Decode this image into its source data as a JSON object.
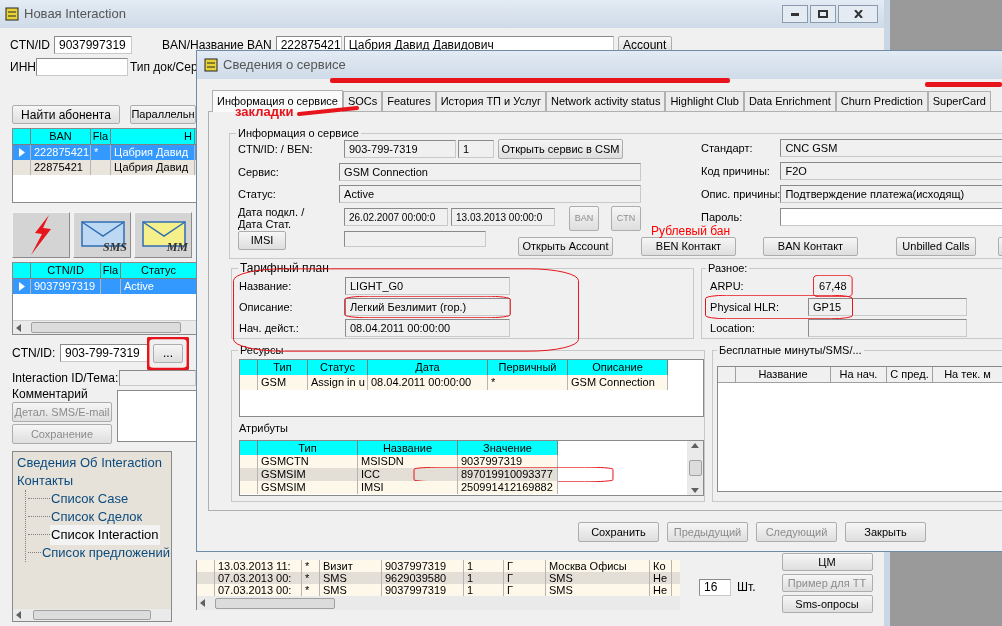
{
  "main_window": {
    "title": "Новая Interaction",
    "search": {
      "ctn_label": "CTN/ID",
      "ctn_value": "9037997319",
      "ban_label": "BAN/Название BAN",
      "ban_value": "222875421",
      "ban_name": "Цабрия Давид Давидович",
      "account_button": "Account",
      "inn_label": "ИНН",
      "doc_label": "Тип док/Сер"
    },
    "buttons": [
      "Найти абонента",
      "Параллельн"
    ],
    "ban_table": {
      "columns": [
        "BAN",
        "Fla",
        "Н"
      ],
      "rows": [
        {
          "ban": "222875421",
          "flag": "*",
          "name": "Цабрия Давид",
          "selected": true
        },
        {
          "ban": "22875421",
          "name": "Цабрия Давид",
          "selected": false
        }
      ]
    },
    "icon_buttons": [
      {
        "kind": "lightning"
      },
      {
        "kind": "envelope",
        "caption": "SMS"
      },
      {
        "kind": "envelope_yellow",
        "caption": "MM"
      }
    ],
    "ctn_table": {
      "columns": [
        "CTN/ID",
        "Fla",
        "Статус"
      ],
      "rows": [
        {
          "ctn": "9037997319",
          "status": "Active",
          "selected": true
        }
      ]
    },
    "ctn": {
      "label": "CTN/ID:",
      "value": "903-799-7319",
      "button": "..."
    },
    "interaction_label": "Interaction ID/Тема:",
    "comment_label": "Комментарий",
    "action_buttons": [
      {
        "label": "Детал. SMS/E-mail",
        "disabled": true
      },
      {
        "label": "Сохранение",
        "disabled": true
      }
    ],
    "tree": [
      {
        "label": "Сведения Об Interaction",
        "selected": false
      },
      {
        "label": "Контакты",
        "selected": false,
        "children": [
          {
            "label": "Список Case",
            "selected": false
          },
          {
            "label": "Список Сделок",
            "selected": false
          },
          {
            "label": "Список Interaction",
            "selected": true
          },
          {
            "label": "Список предложений",
            "selected": false
          }
        ]
      }
    ],
    "history_table": {
      "rows": [
        {
          "cells": [
            "13.03.2013 11:",
            "*",
            "Визит",
            "9037997319",
            "1",
            "Г",
            "Москва Офисы",
            "Ко"
          ],
          "selected": false
        },
        {
          "cells": [
            "07.03.2013 00:",
            "*",
            "SMS",
            "9629039580",
            "1",
            "Г",
            "SMS",
            "Не"
          ],
          "selected": true
        },
        {
          "cells": [
            "07.03.2013 00:",
            "*",
            "SMS",
            "9037997319",
            "1",
            "Г",
            "SMS",
            "Не"
          ],
          "selected": false
        }
      ]
    },
    "count": {
      "value": "16",
      "unit": "Шт."
    },
    "side_buttons": [
      {
        "label": "ЦМ",
        "disabled": false
      },
      {
        "label": "Пример для ТТ",
        "disabled": true
      },
      {
        "label": "Sms-опросы",
        "disabled": false
      }
    ]
  },
  "dialog": {
    "title": "Сведения о сервисе",
    "tabs": [
      {
        "label": "Информация о сервисе",
        "selected": true
      },
      {
        "label": "SOCs",
        "selected": false
      },
      {
        "label": "Features",
        "selected": false
      },
      {
        "label": "История ТП и Услуг",
        "selected": false
      },
      {
        "label": "Network activity status",
        "selected": false
      },
      {
        "label": "Highlight Club",
        "selected": false
      },
      {
        "label": "Data Enrichment",
        "selected": false
      },
      {
        "label": "Churn Prediction",
        "selected": false
      },
      {
        "label": "SuperCard",
        "selected": false
      }
    ],
    "service_info": {
      "title": "Информация о сервисе",
      "ctn_label": "CTN/ID: / BEN:",
      "ctn": "903-799-7319",
      "ben": "1",
      "open_csm": "Открыть сервис в CSM",
      "service_label": "Сервис:",
      "service": "GSM Connection",
      "status_label": "Статус:",
      "status": "Active",
      "date_label_lines": [
        "Дата подкл. /",
        "Дата Стат."
      ],
      "date_connected": "26.02.2007 00:00:0",
      "date_status": "13.03.2013 00:00:0",
      "imsi_button": "IMSI",
      "small_buttons": [
        {
          "label": "BAN",
          "disabled": true
        },
        {
          "label": "CTN",
          "disabled": true
        }
      ],
      "right_fields": [
        {
          "label": "Стандарт:",
          "value": "CNC GSM"
        },
        {
          "label": "Код причины:",
          "value": "F2O"
        },
        {
          "label": "Опис. причины:",
          "value": "Подтверждение платежа(исходящ)"
        },
        {
          "label": "Пароль:"
        }
      ],
      "buttons": [
        {
          "label": "Открыть Account"
        },
        {
          "label": "BEN Контакт"
        },
        {
          "label": "BAN Контакт"
        },
        {
          "label": "Unbilled Calls"
        }
      ]
    },
    "tariff": {
      "title": "Тарифный план",
      "fields": [
        {
          "label": "Название:",
          "value": "LIGHT_G0"
        },
        {
          "label": "Описание:",
          "value": "Легкий Безлимит (гор.)"
        },
        {
          "label": "Нач. дейст.:",
          "value": "08.04.2011 00:00:00"
        }
      ]
    },
    "misc": {
      "title": "Разное:",
      "fields": [
        {
          "label": "ARPU:",
          "value": "67,48",
          "kind": "plain"
        },
        {
          "label": "Physical HLR:",
          "value": "GP15",
          "kind": "box"
        },
        {
          "label": "Location:",
          "kind": "box"
        }
      ]
    },
    "resources": {
      "title": "Ресурсы",
      "columns": [
        "Тип",
        "Статус",
        "Дата",
        "Первичный",
        "Описание"
      ],
      "rows": [
        {
          "cells": [
            "GSM",
            "Assign in u",
            "08.04.2011 00:00:00",
            "*",
            "GSM Connection"
          ]
        }
      ]
    },
    "attributes": {
      "title": "Атрибуты",
      "columns": [
        "Тип",
        "Название",
        "Значение"
      ],
      "rows": [
        {
          "cells": [
            "GSMCTN",
            "MSISDN",
            "9037997319"
          ],
          "selected": false
        },
        {
          "cells": [
            "GSMSIM",
            "ICC",
            "897019910093377"
          ],
          "selected": true
        },
        {
          "cells": [
            "GSMSIM",
            "IMSI",
            "250991412169882"
          ],
          "selected": false
        }
      ]
    },
    "free_minutes": {
      "title": "Бесплатные минуты/SMS/...",
      "columns": [
        "Название",
        "На нач.",
        "С пред.",
        "На тек. м"
      ]
    },
    "buttons": [
      {
        "label": "Сохранить",
        "disabled": false
      },
      {
        "label": "Предыдущий",
        "disabled": true
      },
      {
        "label": "Следующий",
        "disabled": true
      },
      {
        "label": "Закрыть",
        "disabled": false
      }
    ]
  },
  "annotations": {
    "tabs_note": "закладки",
    "ban_note": "Рублевый бан"
  }
}
